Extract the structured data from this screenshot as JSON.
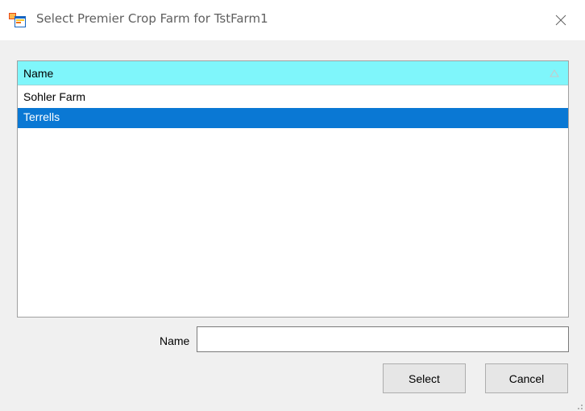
{
  "window": {
    "title": "Select Premier Crop Farm for TstFarm1",
    "app_icon": "form-window-icon",
    "close_icon": "close-icon"
  },
  "grid": {
    "column_header": "Name",
    "sort_icon": "sort-ascending-icon",
    "rows": [
      {
        "label": "Sohler Farm",
        "selected": false
      },
      {
        "label": "Terrells",
        "selected": true
      }
    ],
    "colors": {
      "header_bg": "#7ff6fb",
      "selection_bg": "#0a78d4"
    }
  },
  "filter": {
    "label": "Name",
    "value": "",
    "placeholder": ""
  },
  "buttons": {
    "select_label": "Select",
    "cancel_label": "Cancel"
  }
}
